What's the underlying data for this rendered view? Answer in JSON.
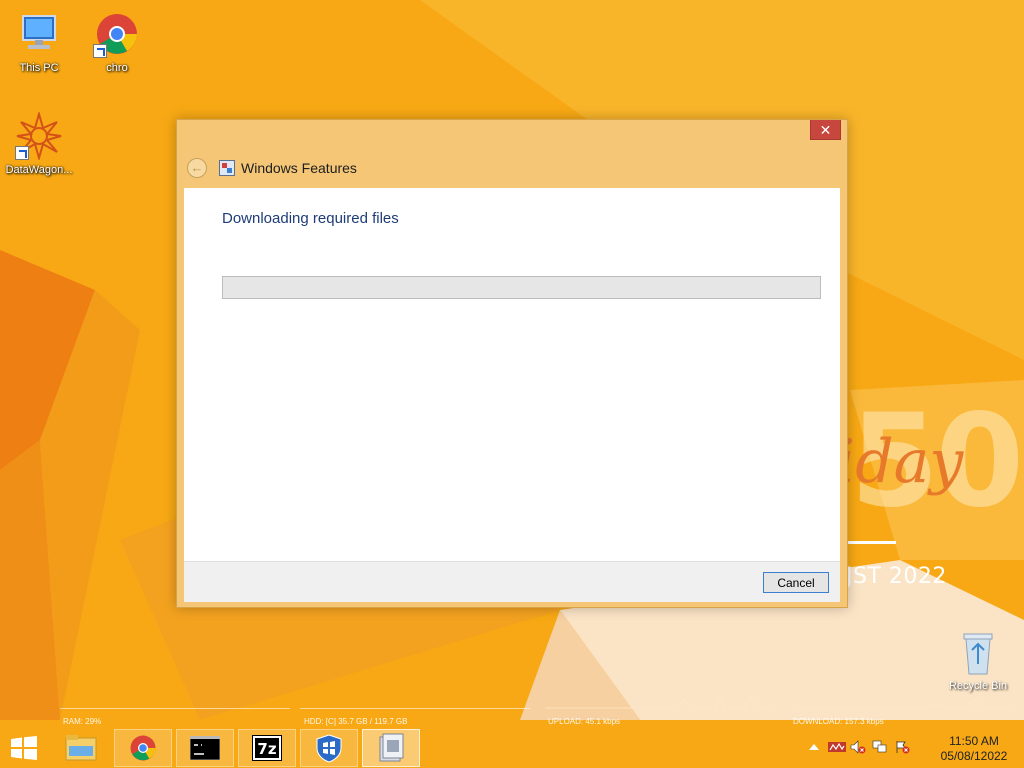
{
  "desktop": {
    "icons": [
      {
        "label": "This PC"
      },
      {
        "label": "chro"
      },
      {
        "label": "DataWagon..."
      }
    ],
    "recycle_bin": {
      "label": "Recycle Bin"
    },
    "wallpaper_text": {
      "big": "50",
      "script": "iday",
      "date": "JST 2022"
    }
  },
  "dialog": {
    "title": "Windows Features",
    "close_label": "✕",
    "heading": "Downloading required files",
    "progress_percent": 0,
    "cancel_label": "Cancel"
  },
  "monitor": {
    "ram": "RAM: 29%",
    "hdd": "HDD: [C] 35.7 GB / 119.7 GB",
    "upload": "UPLOAD: 45.1 kbps",
    "download": "DOWNLOAD: 157.3 kbps"
  },
  "taskbar": {
    "items": [
      "start",
      "file-explorer",
      "chrome",
      "command-prompt",
      "7zip",
      "windows-security",
      "windows-features"
    ],
    "clock": {
      "time": "11:50 AM",
      "date": "05/08/12022"
    }
  },
  "colors": {
    "wallpaper": "#f7a814",
    "dialog_frame": "#f4c676",
    "close": "#c7463d",
    "heading": "#1e3c78"
  }
}
